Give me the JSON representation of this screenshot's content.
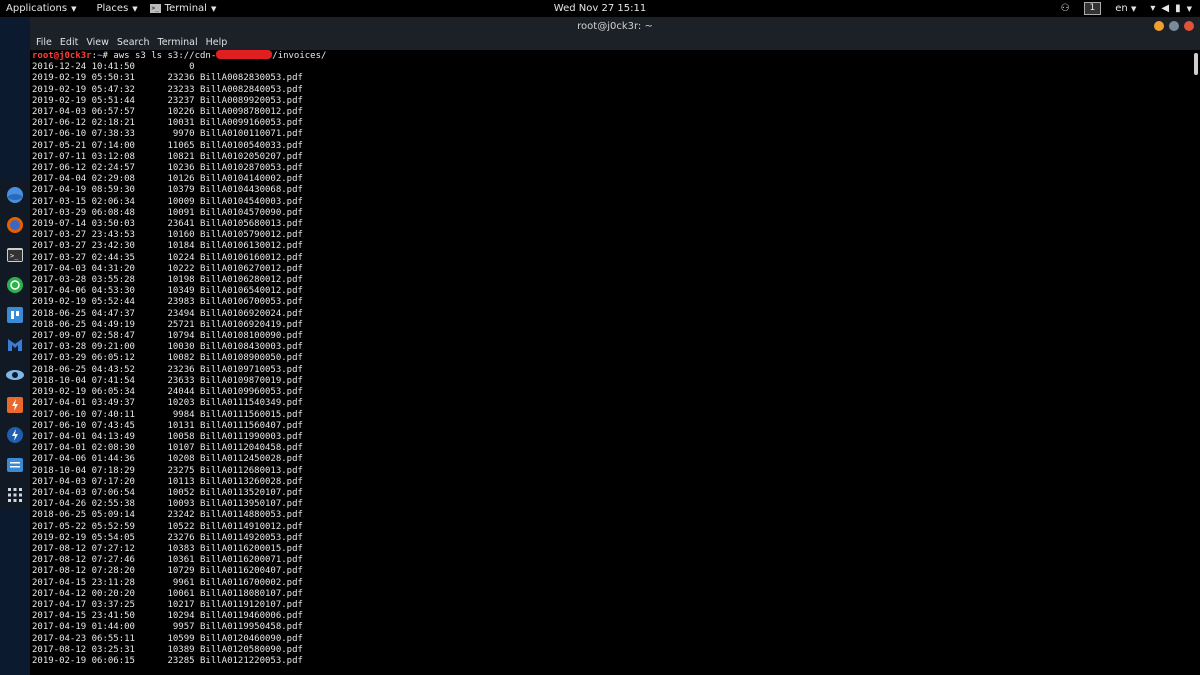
{
  "topbar": {
    "applications": "Applications",
    "places": "Places",
    "terminal": "Terminal",
    "clock": "Wed Nov 27  15:11",
    "workspace": "1",
    "lang": "en"
  },
  "window": {
    "title": "root@j0ck3r: ~",
    "menu": [
      "File",
      "Edit",
      "View",
      "Search",
      "Terminal",
      "Help"
    ]
  },
  "terminal": {
    "prompt_user": "root@j0ck3r",
    "prompt_sep": ":",
    "prompt_path": "~",
    "prompt_hash": "# ",
    "command_prefix": "aws s3 ls s3://cdn-",
    "command_suffix": "/invoices/",
    "rows": [
      {
        "date": "2016-12-24 10:41:50",
        "size": "0",
        "name": ""
      },
      {
        "date": "2019-02-19 05:50:31",
        "size": "23236",
        "name": "BillA0082830053.pdf"
      },
      {
        "date": "2019-02-19 05:47:32",
        "size": "23233",
        "name": "BillA0082840053.pdf"
      },
      {
        "date": "2019-02-19 05:51:44",
        "size": "23237",
        "name": "BillA0089920053.pdf"
      },
      {
        "date": "2017-04-03 06:57:57",
        "size": "10226",
        "name": "BillA0098780012.pdf"
      },
      {
        "date": "2017-06-12 02:18:21",
        "size": "10031",
        "name": "BillA0099160053.pdf"
      },
      {
        "date": "2017-06-10 07:38:33",
        "size": "9970",
        "name": "BillA0100110071.pdf"
      },
      {
        "date": "2017-05-21 07:14:00",
        "size": "11065",
        "name": "BillA0100540033.pdf"
      },
      {
        "date": "2017-07-11 03:12:08",
        "size": "10821",
        "name": "BillA0102050207.pdf"
      },
      {
        "date": "2017-06-12 02:24:57",
        "size": "10236",
        "name": "BillA0102870053.pdf"
      },
      {
        "date": "2017-04-04 02:29:08",
        "size": "10126",
        "name": "BillA0104140002.pdf"
      },
      {
        "date": "2017-04-19 08:59:30",
        "size": "10379",
        "name": "BillA0104430068.pdf"
      },
      {
        "date": "2017-03-15 02:06:34",
        "size": "10009",
        "name": "BillA0104540003.pdf"
      },
      {
        "date": "2017-03-29 06:08:48",
        "size": "10091",
        "name": "BillA0104570090.pdf"
      },
      {
        "date": "2019-07-14 03:50:03",
        "size": "23641",
        "name": "BillA0105680013.pdf"
      },
      {
        "date": "2017-03-27 23:43:53",
        "size": "10160",
        "name": "BillA0105790012.pdf"
      },
      {
        "date": "2017-03-27 23:42:30",
        "size": "10184",
        "name": "BillA0106130012.pdf"
      },
      {
        "date": "2017-03-27 02:44:35",
        "size": "10224",
        "name": "BillA0106160012.pdf"
      },
      {
        "date": "2017-04-03 04:31:20",
        "size": "10222",
        "name": "BillA0106270012.pdf"
      },
      {
        "date": "2017-03-28 03:55:28",
        "size": "10198",
        "name": "BillA0106280012.pdf"
      },
      {
        "date": "2017-04-06 04:53:30",
        "size": "10349",
        "name": "BillA0106540012.pdf"
      },
      {
        "date": "2019-02-19 05:52:44",
        "size": "23983",
        "name": "BillA0106700053.pdf"
      },
      {
        "date": "2018-06-25 04:47:37",
        "size": "23494",
        "name": "BillA0106920024.pdf"
      },
      {
        "date": "2018-06-25 04:49:19",
        "size": "25721",
        "name": "BillA0106920419.pdf"
      },
      {
        "date": "2017-09-07 02:58:47",
        "size": "10794",
        "name": "BillA0108100090.pdf"
      },
      {
        "date": "2017-03-28 09:21:00",
        "size": "10030",
        "name": "BillA0108430003.pdf"
      },
      {
        "date": "2017-03-29 06:05:12",
        "size": "10082",
        "name": "BillA0108900050.pdf"
      },
      {
        "date": "2018-06-25 04:43:52",
        "size": "23236",
        "name": "BillA0109710053.pdf"
      },
      {
        "date": "2018-10-04 07:41:54",
        "size": "23633",
        "name": "BillA0109870019.pdf"
      },
      {
        "date": "2019-02-19 06:05:34",
        "size": "24044",
        "name": "BillA0109960053.pdf"
      },
      {
        "date": "2017-04-01 03:49:37",
        "size": "10203",
        "name": "BillA0111540349.pdf"
      },
      {
        "date": "2017-06-10 07:40:11",
        "size": "9984",
        "name": "BillA0111560015.pdf"
      },
      {
        "date": "2017-06-10 07:43:45",
        "size": "10131",
        "name": "BillA0111560407.pdf"
      },
      {
        "date": "2017-04-01 04:13:49",
        "size": "10058",
        "name": "BillA0111990003.pdf"
      },
      {
        "date": "2017-04-01 02:08:30",
        "size": "10107",
        "name": "BillA0112040458.pdf"
      },
      {
        "date": "2017-04-06 01:44:36",
        "size": "10208",
        "name": "BillA0112450028.pdf"
      },
      {
        "date": "2018-10-04 07:18:29",
        "size": "23275",
        "name": "BillA0112680013.pdf"
      },
      {
        "date": "2017-04-03 07:17:20",
        "size": "10113",
        "name": "BillA0113260028.pdf"
      },
      {
        "date": "2017-04-03 07:06:54",
        "size": "10052",
        "name": "BillA0113520107.pdf"
      },
      {
        "date": "2017-04-26 02:55:38",
        "size": "10093",
        "name": "BillA0113950107.pdf"
      },
      {
        "date": "2018-06-25 05:09:14",
        "size": "23242",
        "name": "BillA0114880053.pdf"
      },
      {
        "date": "2017-05-22 05:52:59",
        "size": "10522",
        "name": "BillA0114910012.pdf"
      },
      {
        "date": "2019-02-19 05:54:05",
        "size": "23276",
        "name": "BillA0114920053.pdf"
      },
      {
        "date": "2017-08-12 07:27:12",
        "size": "10383",
        "name": "BillA0116200015.pdf"
      },
      {
        "date": "2017-08-12 07:27:46",
        "size": "10361",
        "name": "BillA0116200071.pdf"
      },
      {
        "date": "2017-08-12 07:28:20",
        "size": "10729",
        "name": "BillA0116200407.pdf"
      },
      {
        "date": "2017-04-15 23:11:28",
        "size": "9961",
        "name": "BillA0116700002.pdf"
      },
      {
        "date": "2017-04-12 00:20:20",
        "size": "10061",
        "name": "BillA0118080107.pdf"
      },
      {
        "date": "2017-04-17 03:37:25",
        "size": "10217",
        "name": "BillA0119120107.pdf"
      },
      {
        "date": "2017-04-15 23:41:50",
        "size": "10294",
        "name": "BillA0119460006.pdf"
      },
      {
        "date": "2017-04-19 01:44:00",
        "size": "9957",
        "name": "BillA0119950458.pdf"
      },
      {
        "date": "2017-04-23 06:55:11",
        "size": "10599",
        "name": "BillA0120460090.pdf"
      },
      {
        "date": "2017-08-12 03:25:31",
        "size": "10389",
        "name": "BillA0120580090.pdf"
      },
      {
        "date": "2019-02-19 06:06:15",
        "size": "23285",
        "name": "BillA0121220053.pdf"
      }
    ]
  },
  "colors": {
    "prompt_user": "#ff3b3b",
    "prompt_path": "#5a8cff",
    "redaction": "#e02020",
    "btn_min": "#f0a030",
    "btn_max": "#7b8a99",
    "btn_close": "#e0533a"
  },
  "dock_icons": [
    "blue-globe-icon",
    "firefox-icon",
    "terminal-app-icon",
    "green-app-icon",
    "blue-square-app-icon",
    "metasploit-icon",
    "eye-icon",
    "burp-icon",
    "zap-icon",
    "settings-icon",
    "app-grid-icon"
  ]
}
